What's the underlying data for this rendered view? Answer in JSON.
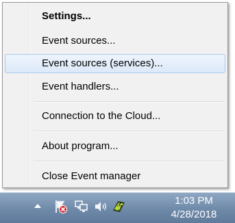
{
  "menu": {
    "items": [
      {
        "label": "Settings..."
      },
      {
        "label": "Event sources..."
      },
      {
        "label": "Event sources (services)..."
      },
      {
        "label": "Event handlers..."
      },
      {
        "label": "Connection to the Cloud..."
      },
      {
        "label": "About program..."
      },
      {
        "label": "Close Event manager"
      }
    ],
    "highlighted_index": 2
  },
  "taskbar": {
    "clock": {
      "time": "1:03 PM",
      "date": "4/28/2018"
    },
    "tray_icons": [
      "show-hidden-icons-arrow",
      "action-center-flag-icon",
      "network-icon",
      "volume-icon",
      "event-manager-icon"
    ]
  },
  "colors": {
    "menu_background": "#f1f1f1",
    "highlight_background": "#dce9f9",
    "highlight_border": "#a8c8ee",
    "taskbar": "#7790ae"
  }
}
